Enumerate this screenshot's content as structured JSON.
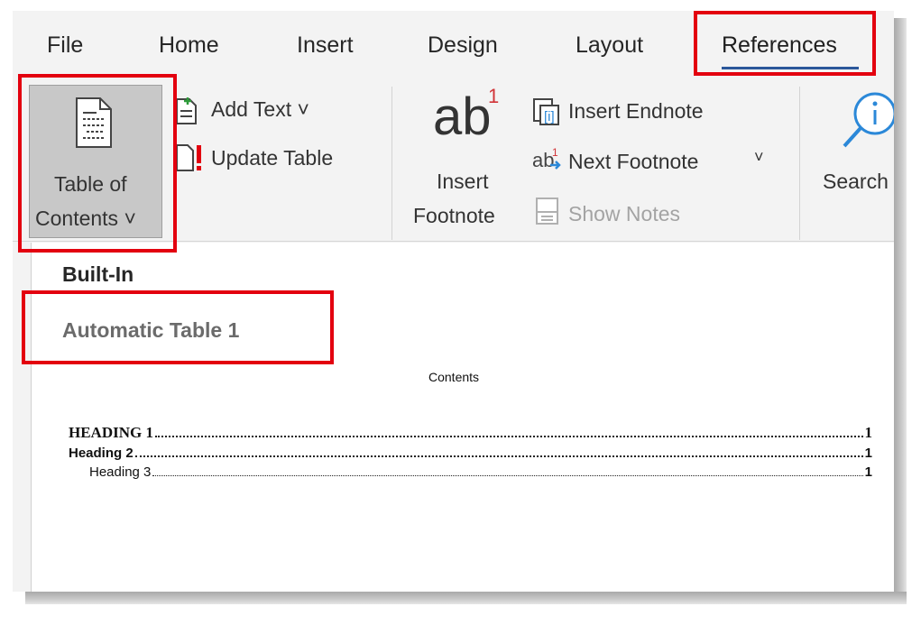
{
  "tabs": [
    {
      "label": "File"
    },
    {
      "label": "Home"
    },
    {
      "label": "Insert"
    },
    {
      "label": "Design"
    },
    {
      "label": "Layout"
    },
    {
      "label": "References",
      "active": true
    }
  ],
  "ribbon": {
    "toc_button": {
      "line1": "Table of",
      "line2": "Contents ˅",
      "icon": "document-icon"
    },
    "add_text": {
      "label": "Add Text ˅",
      "icon": "add-text-icon"
    },
    "update_table": {
      "label": "Update Table",
      "icon": "update-table-icon"
    },
    "insert_footnote": {
      "glyph": "ab",
      "superscript": "1",
      "line1": "Insert",
      "line2": "Footnote"
    },
    "insert_endnote": {
      "label": "Insert Endnote",
      "icon": "insert-endnote-icon"
    },
    "next_footnote": {
      "label": "Next Footnote",
      "chevron": "˅",
      "icon": "next-footnote-icon"
    },
    "show_notes": {
      "label": "Show Notes",
      "icon": "show-notes-icon",
      "disabled": true
    },
    "search": {
      "label": "Search",
      "icon": "smart-lookup-icon"
    }
  },
  "dropdown": {
    "section_header": "Built-In",
    "item_title": "Automatic Table 1",
    "preview": {
      "heading": "Contents",
      "entries": [
        {
          "text": "HEADING 1",
          "page": "1"
        },
        {
          "text": "Heading 2",
          "page": "1"
        },
        {
          "text": "Heading 3",
          "page": "1"
        }
      ]
    }
  },
  "colors": {
    "highlight": "#e3000f",
    "active_tab_underline": "#2b579a",
    "ribbon_bg": "#f3f3f3",
    "toc_button_bg": "#c8c8c8",
    "footnote_superscript": "#d13438",
    "icon_blue": "#2b88d8"
  }
}
